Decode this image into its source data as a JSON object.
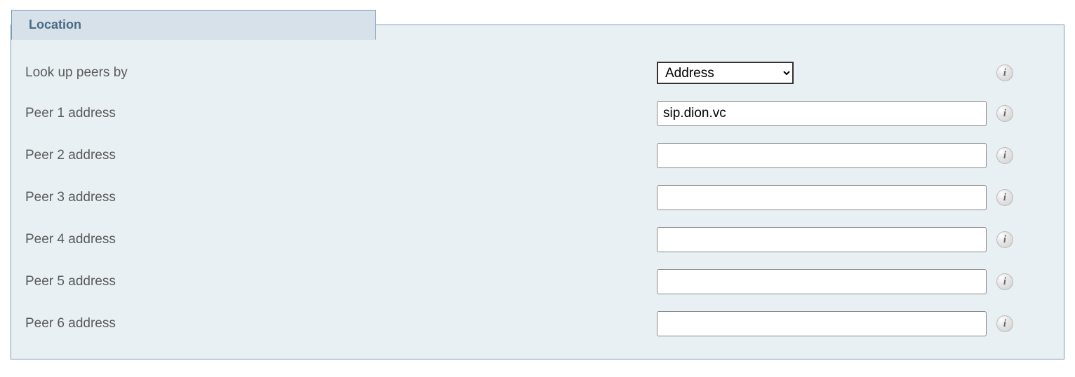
{
  "section": {
    "title": "Location"
  },
  "lookup": {
    "label": "Look up peers by",
    "selected": "Address"
  },
  "peers": [
    {
      "label": "Peer 1 address",
      "value": "sip.dion.vc"
    },
    {
      "label": "Peer 2 address",
      "value": ""
    },
    {
      "label": "Peer 3 address",
      "value": ""
    },
    {
      "label": "Peer 4 address",
      "value": ""
    },
    {
      "label": "Peer 5 address",
      "value": ""
    },
    {
      "label": "Peer 6 address",
      "value": ""
    }
  ],
  "info_glyph": "i"
}
